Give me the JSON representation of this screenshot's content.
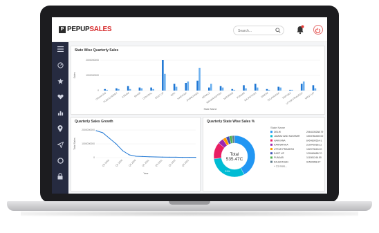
{
  "app": {
    "logo_glyph": "P",
    "logo_main": "PEPUP",
    "logo_accent": "SALES",
    "search_placeholder": "Search...",
    "accent_color": "#d62728",
    "sidebar_bg": "#262b40"
  },
  "sidebar": {
    "items": [
      {
        "icon": "menu-icon"
      },
      {
        "icon": "dashboard-icon"
      },
      {
        "icon": "star-icon"
      },
      {
        "icon": "heart-icon"
      },
      {
        "icon": "bar-chart-icon"
      },
      {
        "icon": "location-pin-icon"
      },
      {
        "icon": "send-icon"
      },
      {
        "icon": "circle-icon"
      },
      {
        "icon": "lock-icon"
      }
    ]
  },
  "cards": {
    "state_wise": "State Wise Quarterly Sales",
    "growth": "Quarterly Sales Growth",
    "donut": "Quarterly State Wise Sales %"
  },
  "chart_data": [
    {
      "type": "bar",
      "title": "State Wise Quarterly Sales",
      "xlabel": "State Name",
      "ylabel": "Sales",
      "ylim": [
        0,
        2000000000
      ],
      "yticks": [
        "2000000000",
        "1000000000",
        "0"
      ],
      "categories": [
        "Uttaranchal",
        "PUDUCHERRY",
        "ASSAM",
        "BIHAR",
        "CENTRAL",
        "EAST UP",
        "GOA",
        "HARYANA",
        "JHARKHAND",
        "KERALA",
        "MAHARASHTRA",
        "MIZORAM",
        "PUNJAB",
        "RAJASTHAN",
        "SIKKIM",
        "TELANGANA",
        "TRIPURA",
        "UTTAR PRADESH",
        "WEST UP"
      ],
      "colors": [
        "#1f77d4",
        "#6cb0ef"
      ],
      "series": [
        {
          "values": [
            100000000.0,
            150000000.0,
            300000000.0,
            200000000.0,
            200000000.0,
            2000000000.0,
            450000000.0,
            500000000.0,
            650000000.0,
            200000000.0,
            300000000.0,
            100000000.0,
            350000000.0,
            450000000.0,
            100000000.0,
            250000000.0,
            50000000.0,
            450000000.0,
            350000000.0
          ]
        },
        {
          "values": [
            50000000.0,
            100000000.0,
            100000000.0,
            150000000.0,
            100000000.0,
            1100000000.0,
            250000000.0,
            600000000.0,
            1500000000.0,
            450000000.0,
            200000000.0,
            50000000.0,
            150000000.0,
            200000000.0,
            50000000.0,
            200000000.0,
            50000000.0,
            600000000.0,
            150000000.0
          ]
        }
      ]
    },
    {
      "type": "line",
      "title": "Quarterly Sales Growth",
      "xlabel": "Year",
      "ylabel": "Total Sales",
      "ylim": [
        0,
        2000000000
      ],
      "yticks": [
        "2000000000",
        "1000000000",
        "0"
      ],
      "categories": [
        "Q1 2019",
        "Q2 2019",
        "Q3 2019",
        "Q4 2019",
        "Q1 2020",
        "Q2 2020",
        "Q3 2020",
        "Q4 2020",
        "Q1 2021",
        "Q2 2021",
        "Q3 2021",
        "Q4 2021",
        "Q1 2022",
        "Q2 2022",
        "Q3 2022",
        "Q4 2022"
      ],
      "tick_labels": [
        "Q3 2019",
        "Q1 2020",
        "Q3 2020",
        "Q1 2021",
        "Q3 2021",
        "Q1 2022",
        "Q3 2022"
      ],
      "color": "#1f77d4",
      "values": [
        1950000000.0,
        1800000000.0,
        1400000000.0,
        1000000000.0,
        500000000.0,
        200000000.0,
        100000000.0,
        80000000.0,
        60000000.0,
        50000000.0,
        40000000.0,
        30000000.0,
        30000000.0,
        20000000.0,
        20000000.0,
        20000000.0
      ]
    },
    {
      "type": "pie",
      "title": "Quarterly State Wise Sales %",
      "center_label": "Total",
      "center_value": "535.47C",
      "slice_label": "31%",
      "legend_title": "State Name",
      "slices": [
        {
          "name": "DELHI",
          "value": 2064105268.79,
          "label": "2064105268.79",
          "color": "#2196f3"
        },
        {
          "name": "JAMMU AND KASHMIR",
          "value": 1503784469.0,
          "label": "1503784469.00",
          "color": "#00bcd4"
        },
        {
          "name": "HARYANA",
          "value": 645460055.41,
          "label": "645460055.41",
          "color": "#e91e63"
        },
        {
          "name": "KARNATAKA",
          "value": 210940266.11,
          "label": "210940266.11",
          "color": "#9c27b0"
        },
        {
          "name": "UTTAR PRADESH",
          "value": 132073618.2,
          "label": "132073618.20",
          "color": "#ff9800"
        },
        {
          "name": "EAST UP",
          "value": 129969688.7,
          "label": "129969688.70",
          "color": "#3f51b5"
        },
        {
          "name": "PUNJAB",
          "value": 111081246.5,
          "label": "111081246.50",
          "color": "#4caf50"
        },
        {
          "name": "RAJASTHAN",
          "value": 91500958.27,
          "label": "91500958.27",
          "color": "#607d8b"
        }
      ],
      "more_label": "+ 31 more..."
    }
  ]
}
